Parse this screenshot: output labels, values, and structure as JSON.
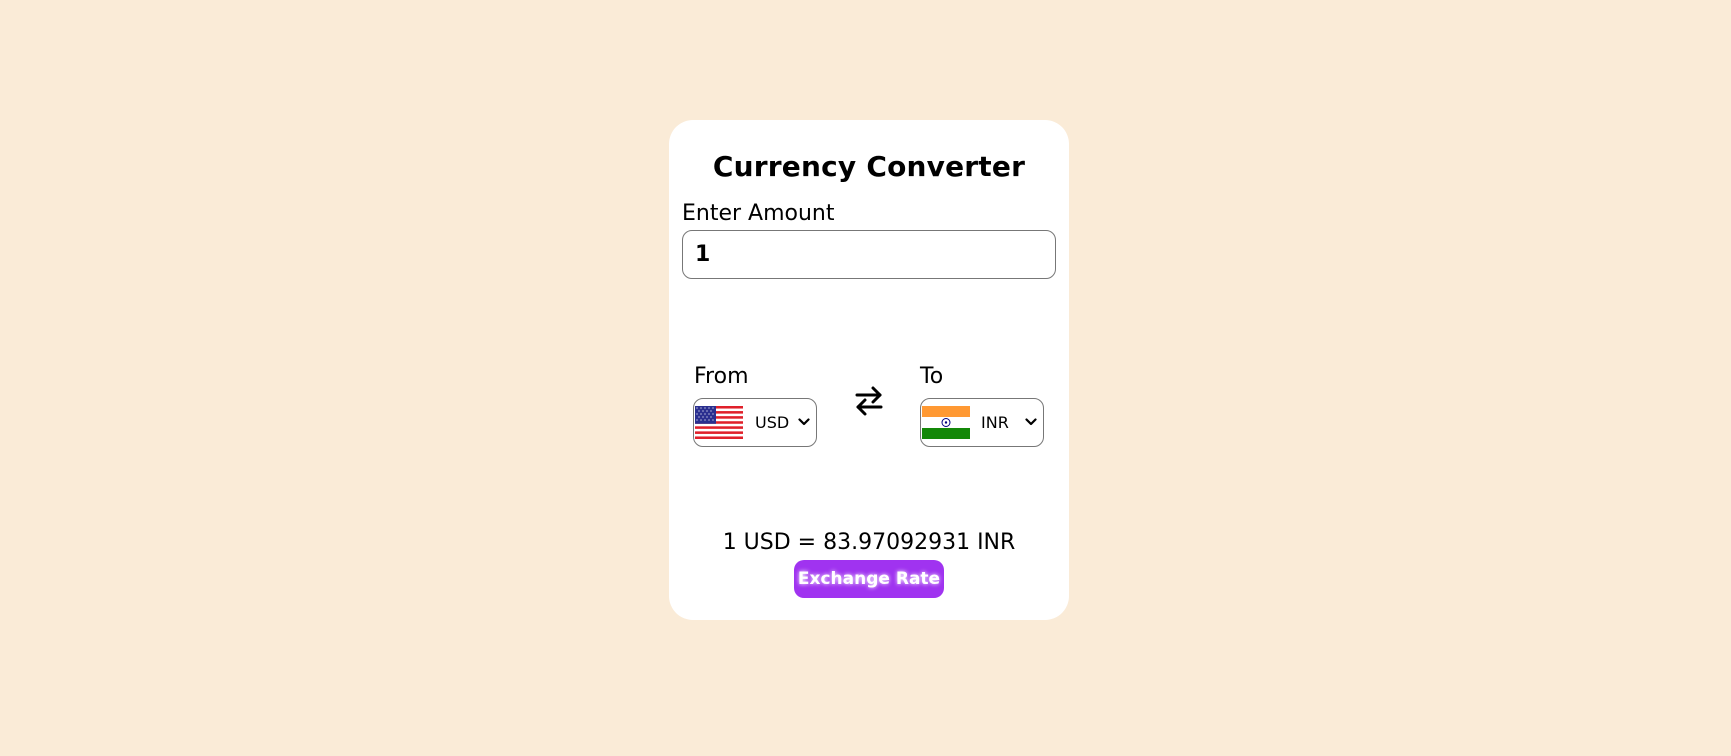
{
  "converter": {
    "title": "Currency Converter",
    "amount_label": "Enter Amount",
    "amount_value": "1",
    "from_label": "From",
    "to_label": "To",
    "from_currency": "USD",
    "to_currency": "INR",
    "from_flag_icon": "us-flag-icon",
    "to_flag_icon": "india-flag-icon",
    "swap_icon": "swap-arrows-icon",
    "result_text": "1 USD = 83.97092931 INR",
    "button_label": "Exchange Rate"
  },
  "colors": {
    "page_background": "#faebd7",
    "card_background": "#ffffff",
    "button_background": "#a033f0",
    "button_text": "#ffffff"
  }
}
